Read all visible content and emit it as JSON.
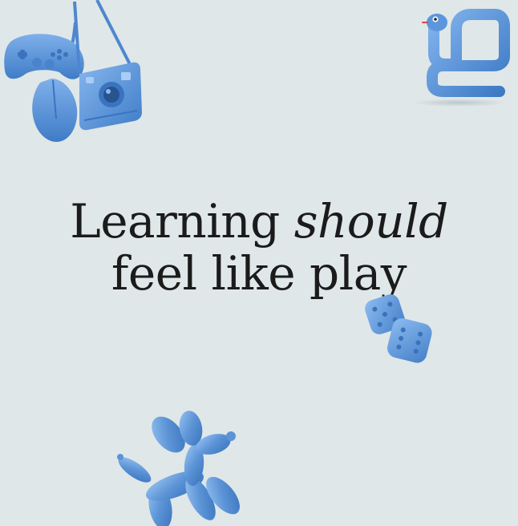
{
  "headline": {
    "line1_prefix": "Learning ",
    "line1_emphasis": "should",
    "line2": "feel like play"
  },
  "colors": {
    "background": "#dfe7e8",
    "text": "#1b1b1b",
    "toy_blue": "#5b93d6"
  },
  "decorations": [
    {
      "name": "gamepad-icon"
    },
    {
      "name": "camera-icon"
    },
    {
      "name": "snake-icon"
    },
    {
      "name": "dice-icon"
    },
    {
      "name": "balloon-dog-icon"
    }
  ]
}
